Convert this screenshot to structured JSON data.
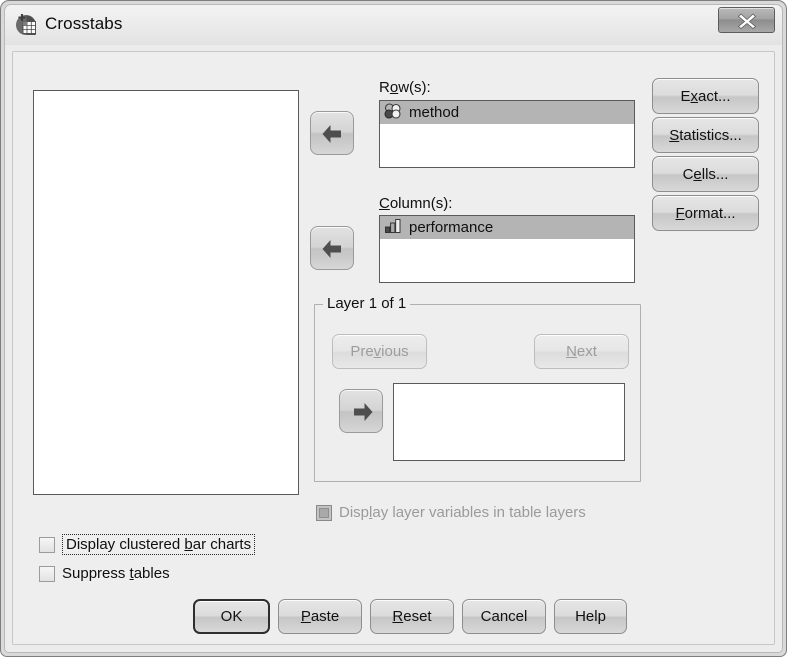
{
  "window": {
    "title": "Crosstabs",
    "icon": "spss-crosstabs-icon",
    "close_label": "x"
  },
  "source_list": {
    "name": "source-variable-list",
    "items": []
  },
  "rows": {
    "label": "Row(s):",
    "accel": "o",
    "items": [
      {
        "name": "method",
        "measure_icon": "nominal-icon",
        "selected": true
      }
    ],
    "move_button": "move-to-rows-button",
    "arrow": "arrow-left-icon"
  },
  "columns": {
    "label": "Column(s):",
    "accel": "C",
    "items": [
      {
        "name": "performance",
        "measure_icon": "ordinal-icon",
        "selected": true
      }
    ],
    "move_button": "move-to-columns-button",
    "arrow": "arrow-left-icon"
  },
  "layer": {
    "title": "Layer 1 of 1",
    "previous_label": "Previous",
    "previous_accel": "v",
    "previous_enabled": false,
    "next_label": "Next",
    "next_accel": "N",
    "next_enabled": false,
    "arrow": "arrow-right-icon",
    "items": []
  },
  "side_buttons": [
    {
      "label": "Exact...",
      "accel": "x",
      "name": "exact-button"
    },
    {
      "label": "Statistics...",
      "accel": "S",
      "name": "statistics-button"
    },
    {
      "label": "Cells...",
      "accel": "e",
      "name": "cells-button"
    },
    {
      "label": "Format...",
      "accel": "F",
      "name": "format-button"
    }
  ],
  "checkboxes": {
    "display_layer_variables": {
      "label": "Display layer variables in table layers",
      "accel": "l",
      "checked": false,
      "enabled": false
    },
    "display_clustered_bar_charts": {
      "label": "Display clustered bar charts",
      "accel": "b",
      "checked": false,
      "enabled": true,
      "focused": true
    },
    "suppress_tables": {
      "label": "Suppress tables",
      "accel": "t",
      "checked": false,
      "enabled": true
    }
  },
  "bottom_buttons": [
    {
      "label": "OK",
      "name": "ok-button",
      "default": true
    },
    {
      "label": "Paste",
      "accel": "P",
      "name": "paste-button"
    },
    {
      "label": "Reset",
      "accel": "R",
      "name": "reset-button"
    },
    {
      "label": "Cancel",
      "name": "cancel-button"
    },
    {
      "label": "Help",
      "name": "help-button"
    }
  ],
  "colors": {
    "dialog_bg": "#eeeeee",
    "listbox_bg": "#ffffff",
    "selection_bg": "#b4b4b4",
    "text": "#0f0f0f",
    "disabled_text": "#9a9a9a"
  }
}
